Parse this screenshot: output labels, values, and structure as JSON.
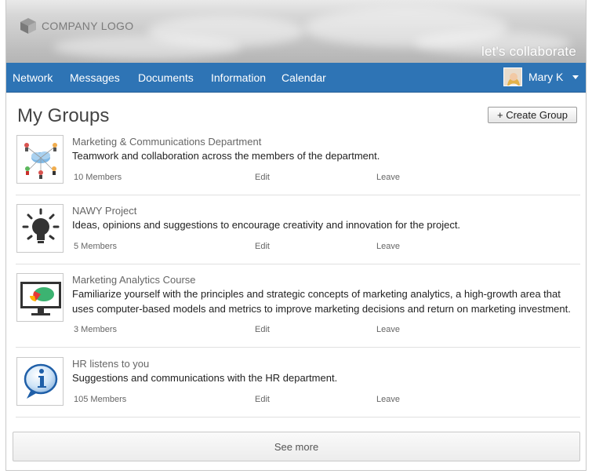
{
  "header": {
    "logo_text": "COMPANY LOGO",
    "tagline": "let's collaborate"
  },
  "nav": {
    "items": [
      {
        "label": "Network"
      },
      {
        "label": "Messages"
      },
      {
        "label": "Documents"
      },
      {
        "label": "Information"
      },
      {
        "label": "Calendar"
      }
    ],
    "user_name": "Mary K"
  },
  "main": {
    "title": "My Groups",
    "create_label": "+ Create Group",
    "groups": [
      {
        "name": "Marketing & Communications Department",
        "description": "Teamwork and collaboration across the members of the department.",
        "members": "10 Members",
        "edit": "Edit",
        "leave": "Leave",
        "icon": "team-network-icon"
      },
      {
        "name": "NAWY Project",
        "description": "Ideas, opinions and suggestions to encourage creativity and innovation for the project.",
        "members": "5 Members",
        "edit": "Edit",
        "leave": "Leave",
        "icon": "lightbulb-icon"
      },
      {
        "name": "Marketing Analytics Course",
        "description": "Familiarize yourself with the principles and strategic concepts of marketing analytics, a high-growth area that uses computer-based models and metrics to improve marketing decisions and return on marketing investment.",
        "members": "3 Members",
        "edit": "Edit",
        "leave": "Leave",
        "icon": "monitor-chart-icon"
      },
      {
        "name": "HR listens to you",
        "description": "Suggestions and communications with the HR department.",
        "members": "105 Members",
        "edit": "Edit",
        "leave": "Leave",
        "icon": "info-bubble-icon"
      }
    ],
    "see_more_label": "See more"
  },
  "colors": {
    "nav_bg": "#2e74b5",
    "page_bg": "#ffffff",
    "text": "#222222"
  }
}
